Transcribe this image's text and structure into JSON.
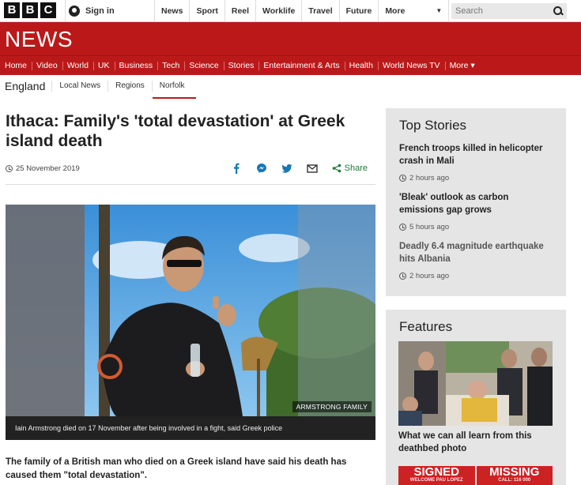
{
  "global_bar": {
    "logo_letters": [
      "B",
      "B",
      "C"
    ],
    "sign_in": "Sign in",
    "nav": [
      "News",
      "Sport",
      "Reel",
      "Worklife",
      "Travel",
      "Future"
    ],
    "more": "More",
    "search_placeholder": "Search"
  },
  "news_header": {
    "wordmark": "NEWS"
  },
  "section_nav": {
    "items": [
      "Home",
      "Video",
      "World",
      "UK",
      "Business",
      "Tech",
      "Science",
      "Stories",
      "Entertainment & Arts",
      "Health",
      "World News TV",
      "More ▾"
    ],
    "active": "UK"
  },
  "sub_nav": {
    "region": "England",
    "items": [
      "Local News",
      "Regions",
      "Norfolk"
    ],
    "active": "Norfolk"
  },
  "article": {
    "headline": "Ithaca: Family's 'total devastation' at Greek island death",
    "date": "25 November 2019",
    "share_label": "Share",
    "image_credit": "ARMSTRONG FAMILY",
    "caption": "Iain Armstrong died on 17 November after being involved in a fight, said Greek police",
    "body": "The family of a British man who died on a Greek island have said his death has caused them \"total devastation\"."
  },
  "top_stories": {
    "heading": "Top Stories",
    "items": [
      {
        "title": "French troops killed in helicopter crash in Mali",
        "time": "2 hours ago"
      },
      {
        "title": "'Bleak' outlook as carbon emissions gap grows",
        "time": "5 hours ago"
      },
      {
        "title": "Deadly 6.4 magnitude earthquake hits Albania",
        "time": "2 hours ago"
      }
    ]
  },
  "features": {
    "heading": "Features",
    "item_title": "What we can all learn from this deathbed photo",
    "promo": [
      {
        "big": "SIGNED",
        "small": "WELCOME PAU LOPEZ"
      },
      {
        "big": "MISSING",
        "small": "CALL: 116 000"
      }
    ]
  },
  "colors": {
    "brand_red": "#bb1919",
    "panel_grey": "#e5e5e5",
    "share_green": "#1a7a3a",
    "social_blue": "#1877b5"
  }
}
